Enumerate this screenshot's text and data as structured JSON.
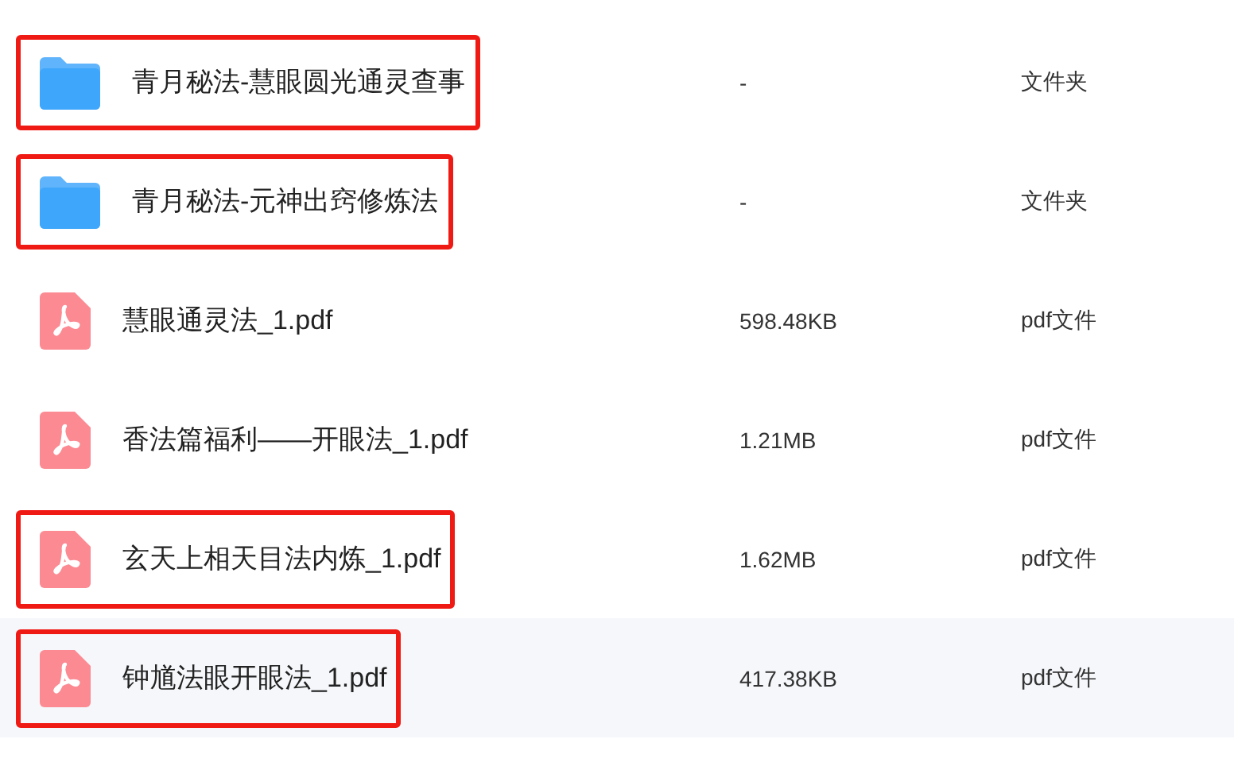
{
  "files": [
    {
      "kind": "folder",
      "name": "青月秘法-慧眼圆光通灵查事",
      "size": "-",
      "type": "文件夹",
      "highlighted": true,
      "hovered": false
    },
    {
      "kind": "folder",
      "name": "青月秘法-元神出窍修炼法",
      "size": "-",
      "type": "文件夹",
      "highlighted": true,
      "hovered": false
    },
    {
      "kind": "pdf",
      "name": "慧眼通灵法_1.pdf",
      "size": "598.48KB",
      "type": "pdf文件",
      "highlighted": false,
      "hovered": false
    },
    {
      "kind": "pdf",
      "name": "香法篇福利——开眼法_1.pdf",
      "size": "1.21MB",
      "type": "pdf文件",
      "highlighted": false,
      "hovered": false
    },
    {
      "kind": "pdf",
      "name": "玄天上相天目法内炼_1.pdf",
      "size": "1.62MB",
      "type": "pdf文件",
      "highlighted": true,
      "hovered": false
    },
    {
      "kind": "pdf",
      "name": "钟馗法眼开眼法_1.pdf",
      "size": "417.38KB",
      "type": "pdf文件",
      "highlighted": true,
      "hovered": true
    }
  ]
}
